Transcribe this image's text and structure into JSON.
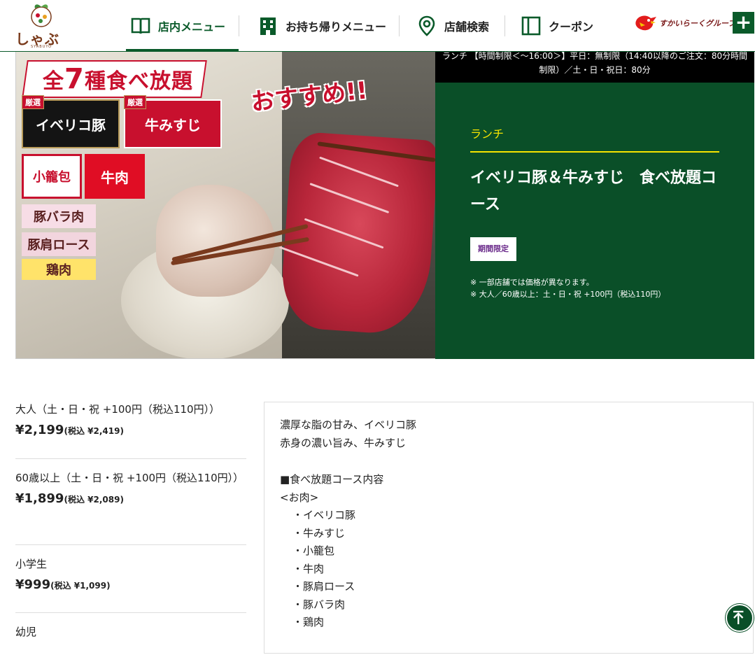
{
  "header": {
    "logo_text": "しゃぶ葉",
    "logo_sub": "SYABUYO",
    "nav": [
      {
        "label": "店内メニュー",
        "icon": "book-icon",
        "active": true
      },
      {
        "label": "お持ち帰りメニュー",
        "icon": "building-icon",
        "active": false
      },
      {
        "label": "店舗検索",
        "icon": "map-pin-icon",
        "active": false
      },
      {
        "label": "クーポン",
        "icon": "coupon-icon",
        "active": false
      }
    ],
    "group_logo_text": "すかいらーくグループ",
    "plus_label": "+"
  },
  "hero": {
    "image_texts": {
      "banner": {
        "prefix": "全",
        "num": "7",
        "unit": "種",
        "rest": "食べ放題"
      },
      "osusume": "おすすめ!!",
      "tags": {
        "iberico": "イベリコ豚",
        "gyusuji": "牛みすじ",
        "xiaolongbao": "小籠包",
        "gyuniku": "牛肉",
        "butabara": "豚バラ肉",
        "butakata": "豚肩ロース",
        "toriniku": "鶏肉",
        "gensen": "厳選"
      }
    },
    "topbar_line1": "ランチ 【時間制限＜～16:00＞】平日：無制限（14:40以降のご注文：80分時間",
    "topbar_line2": "制限）／土・日・祝日：80分",
    "category": "ランチ",
    "title": "イベリコ豚＆牛みすじ　食べ放題コース",
    "badge": "期間限定",
    "note1": "※ 一部店舗では価格が異なります。",
    "note2": "※ 大人／60歳以上：土・日・祝 +100円（税込110円）",
    "colors": {
      "panel_bg": "#0a4f28",
      "accent": "#f5e400",
      "brand_red": "#c8102e"
    }
  },
  "prices": [
    {
      "label": "大人（土・日・祝 +100円（税込110円））",
      "price": "¥2,199",
      "tax": "(税込 ¥2,419)"
    },
    {
      "label": "60歳以上（土・日・祝 +100円（税込110円））",
      "price": "¥1,899",
      "tax": "(税込 ¥2,089)"
    },
    {
      "label": "小学生",
      "price": "¥999",
      "tax": "(税込 ¥1,099)"
    },
    {
      "label": "幼児",
      "price": "",
      "tax": ""
    }
  ],
  "description": {
    "line1": "濃厚な脂の甘み、イベリコ豚",
    "line2": "赤身の濃い旨み、牛みすじ",
    "section": "■食べ放題コース内容",
    "sub": "<お肉>",
    "items": [
      "・イベリコ豚",
      "・牛みすじ",
      "・小籠包",
      "・牛肉",
      "・豚肩ロース",
      "・豚バラ肉",
      "・鶏肉"
    ]
  },
  "back_to_top_label": "ページトップへ"
}
